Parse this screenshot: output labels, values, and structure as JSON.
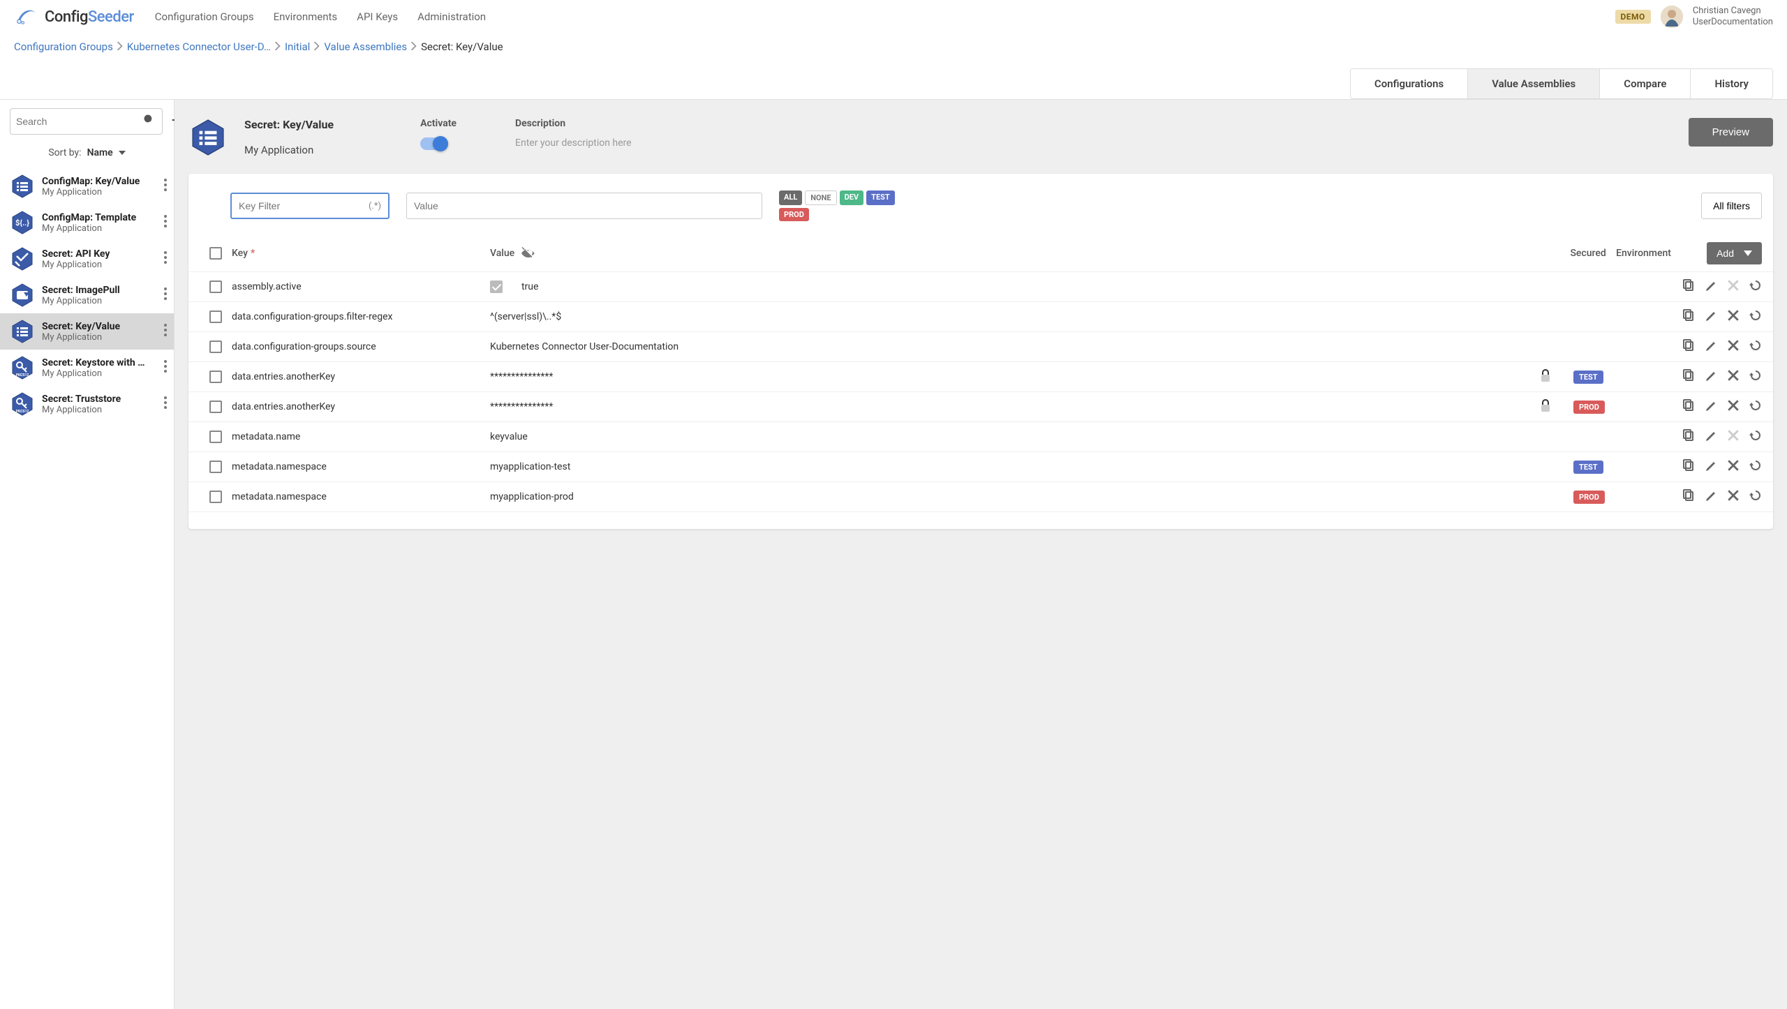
{
  "brand": {
    "name1": "Config",
    "name2": "Seeder"
  },
  "nav": {
    "groups": "Configuration Groups",
    "envs": "Environments",
    "keys": "API Keys",
    "admin": "Administration"
  },
  "header": {
    "demo": "DEMO",
    "user_name": "Christian Cavegn",
    "user_org": "UserDocumentation"
  },
  "breadcrumb": {
    "items": [
      "Configuration Groups",
      "Kubernetes Connector User-D…",
      "Initial",
      "Value Assemblies"
    ],
    "current": "Secret: Key/Value"
  },
  "tabs": {
    "config": "Configurations",
    "va": "Value Assemblies",
    "compare": "Compare",
    "history": "History"
  },
  "sidebar": {
    "search_ph": "Search",
    "sort_label": "Sort by:",
    "sort_value": "Name",
    "items": [
      {
        "title": "ConfigMap: Key/Value",
        "sub": "My Application",
        "icon": "list"
      },
      {
        "title": "ConfigMap: Template",
        "sub": "My Application",
        "icon": "tpl"
      },
      {
        "title": "Secret: API Key",
        "sub": "My Application",
        "icon": "run"
      },
      {
        "title": "Secret: ImagePull",
        "sub": "My Application",
        "icon": "pull"
      },
      {
        "title": "Secret: Key/Value",
        "sub": "My Application",
        "icon": "list",
        "active": true
      },
      {
        "title": "Secret: Keystore with …",
        "sub": "My Application",
        "icon": "pkcs"
      },
      {
        "title": "Secret: Truststore",
        "sub": "My Application",
        "icon": "pkcs"
      }
    ]
  },
  "detail": {
    "title": "Secret: Key/Value",
    "sub": "My Application",
    "activate": "Activate",
    "description": "Description",
    "desc_ph": "Enter your description here",
    "preview": "Preview"
  },
  "filters": {
    "key_ph": "Key Filter",
    "regex": "(.*)",
    "val_ph": "Value",
    "pills": {
      "all": "ALL",
      "none": "NONE",
      "dev": "DEV",
      "test": "TEST",
      "prod": "PROD"
    },
    "all_filters": "All filters"
  },
  "table": {
    "head": {
      "key": "Key",
      "value": "Value",
      "secured": "Secured",
      "env": "Environment",
      "add": "Add"
    },
    "rows": [
      {
        "key": "assembly.active",
        "val": "true",
        "chkval": true,
        "secured": false,
        "env": "",
        "del": false
      },
      {
        "key": "data.configuration-groups.filter-regex",
        "val": "^(server|ssl)\\..*$",
        "secured": false,
        "env": "",
        "del": true
      },
      {
        "key": "data.configuration-groups.source",
        "val": "Kubernetes Connector User-Documentation",
        "secured": false,
        "env": "",
        "del": true
      },
      {
        "key": "data.entries.anotherKey",
        "val": "***************",
        "secured": true,
        "env": "TEST",
        "del": true
      },
      {
        "key": "data.entries.anotherKey",
        "val": "***************",
        "secured": true,
        "env": "PROD",
        "del": true
      },
      {
        "key": "metadata.name",
        "val": "keyvalue",
        "secured": false,
        "env": "",
        "del": false
      },
      {
        "key": "metadata.namespace",
        "val": "myapplication-test",
        "secured": false,
        "env": "TEST",
        "del": true
      },
      {
        "key": "metadata.namespace",
        "val": "myapplication-prod",
        "secured": false,
        "env": "PROD",
        "del": true
      }
    ]
  }
}
